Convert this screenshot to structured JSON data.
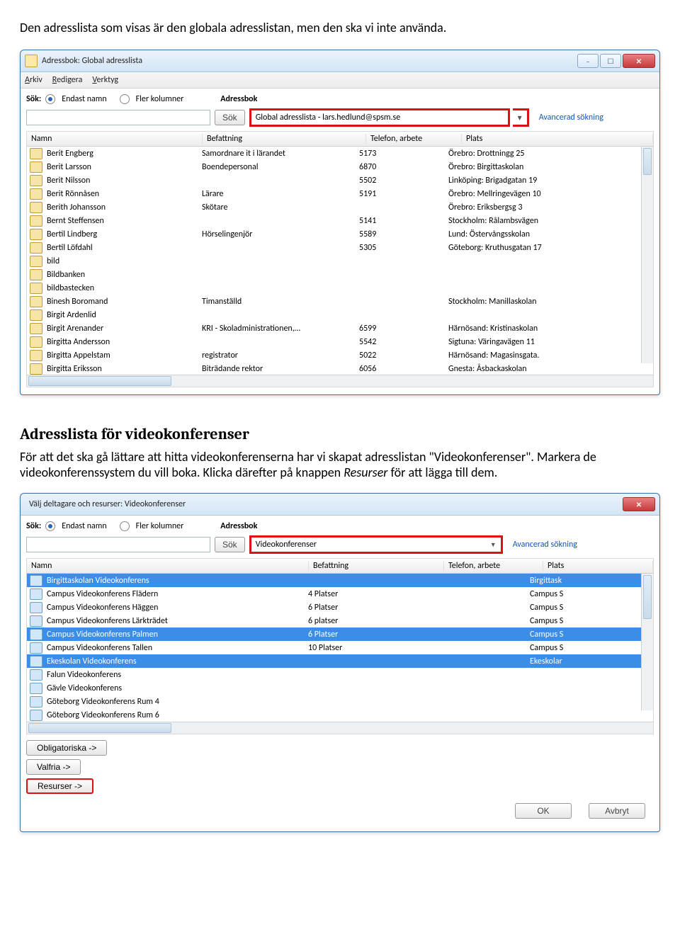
{
  "intro": "Den adresslista som visas är den globala adresslistan, men den ska vi inte använda.",
  "win1": {
    "title": "Adressbok: Global adresslista",
    "menu": [
      "Arkiv",
      "Redigera",
      "Verktyg"
    ],
    "sok": "Sök:",
    "r1": "Endast namn",
    "r2": "Fler kolumner",
    "abLabel": "Adressbok",
    "sokBtn": "Sök",
    "abValue": "Global adresslista - lars.hedlund@spsm.se",
    "adv": "Avancerad sökning",
    "cols": {
      "name": "Namn",
      "bef": "Befattning",
      "tel": "Telefon, arbete",
      "pla": "Plats"
    },
    "rows": [
      {
        "n": "Berit Engberg",
        "b": "Samordnare it i lärandet",
        "t": "5173",
        "p": "Örebro: Drottningg 25"
      },
      {
        "n": "Berit Larsson",
        "b": "Boendepersonal",
        "t": "6870",
        "p": "Örebro: Birgittaskolan"
      },
      {
        "n": "Berit Nilsson",
        "b": "",
        "t": "5502",
        "p": "Linköping: Brigadgatan 19"
      },
      {
        "n": "Berit Rönnåsen",
        "b": "Lärare",
        "t": "5191",
        "p": "Örebro: Mellringevägen 10"
      },
      {
        "n": "Berith Johansson",
        "b": "Skötare",
        "t": "",
        "p": "Örebro: Eriksbergsg 3"
      },
      {
        "n": "Bernt Steffensen",
        "b": "",
        "t": "5141",
        "p": "Stockholm: Rålambsvägen"
      },
      {
        "n": "Bertil Lindberg",
        "b": "Hörselingenjör",
        "t": "5589",
        "p": "Lund: Östervångsskolan"
      },
      {
        "n": "Bertil Löfdahl",
        "b": "",
        "t": "5305",
        "p": "Göteborg: Kruthusgatan 17"
      },
      {
        "n": "bild",
        "b": "",
        "t": "",
        "p": ""
      },
      {
        "n": "Bildbanken",
        "b": "",
        "t": "",
        "p": ""
      },
      {
        "n": "bildbastecken",
        "b": "",
        "t": "",
        "p": ""
      },
      {
        "n": "Binesh Boromand",
        "b": "Timanställd",
        "t": "",
        "p": "Stockholm: Manillaskolan"
      },
      {
        "n": "Birgit Ardenlid",
        "b": "",
        "t": "",
        "p": ""
      },
      {
        "n": "Birgit Arenander",
        "b": "KRI - Skoladministrationen,…",
        "t": "6599",
        "p": "Härnösand: Kristinaskolan"
      },
      {
        "n": "Birgitta Andersson",
        "b": "",
        "t": "5542",
        "p": "Sigtuna: Väringavägen 11"
      },
      {
        "n": "Birgitta Appelstam",
        "b": "registrator",
        "t": "5022",
        "p": "Härnösand: Magasinsgata."
      },
      {
        "n": "Birgitta Eriksson",
        "b": "Biträdande rektor",
        "t": "6056",
        "p": "Gnesta: Åsbackaskolan"
      }
    ]
  },
  "h2": "Adresslista för videokonferenser",
  "para1": "För att det ska gå lättare att hitta videokonferenserna har vi skapat adresslistan \"Videokonferenser\". Markera de videokonferenssystem du vill boka. Klicka därefter på knappen ",
  "paraItalic": "Resurser",
  "para2": " för att lägga till dem.",
  "win2": {
    "title": "Välj deltagare och resurser: Videokonferenser",
    "sok": "Sök:",
    "r1": "Endast namn",
    "r2": "Fler kolumner",
    "abLabel": "Adressbok",
    "sokBtn": "Sök",
    "abValue": "Videokonferenser",
    "adv": "Avancerad sökning",
    "cols": {
      "name": "Namn",
      "bef": "Befattning",
      "tel": "Telefon, arbete",
      "pla": "Plats"
    },
    "rows": [
      {
        "n": "Birgittaskolan Videokonferens",
        "b": "",
        "t": "",
        "p": "Birgittask",
        "sel": true
      },
      {
        "n": "Campus Videokonferens Flädern",
        "b": "4 Platser",
        "t": "",
        "p": "Campus S",
        "sel": false
      },
      {
        "n": "Campus Videokonferens Häggen",
        "b": "6 Platser",
        "t": "",
        "p": "Campus S",
        "sel": false
      },
      {
        "n": "Campus Videokonferens Lärkträdet",
        "b": "6 platser",
        "t": "",
        "p": "Campus S",
        "sel": false
      },
      {
        "n": "Campus Videokonferens Palmen",
        "b": "6 Platser",
        "t": "",
        "p": "Campus S",
        "sel": true
      },
      {
        "n": "Campus Videokonferens Tallen",
        "b": "10 Platser",
        "t": "",
        "p": "Campus S",
        "sel": false
      },
      {
        "n": "Ekeskolan Videokonferens",
        "b": "",
        "t": "",
        "p": "Ekeskolar",
        "sel": true
      },
      {
        "n": "Falun Videokonferens",
        "b": "",
        "t": "",
        "p": "",
        "sel": false
      },
      {
        "n": "Gävle Videokonferens",
        "b": "",
        "t": "",
        "p": "",
        "sel": false
      },
      {
        "n": "Göteborg Videokonferens Rum 4",
        "b": "",
        "t": "",
        "p": "",
        "sel": false
      },
      {
        "n": "Göteborg Videokonferens Rum 6",
        "b": "",
        "t": "",
        "p": "",
        "sel": false
      }
    ],
    "btn1": "Obligatoriska ->",
    "btn2": "Valfria ->",
    "btn3": "Resurser ->",
    "ok": "OK",
    "cancel": "Avbryt"
  }
}
